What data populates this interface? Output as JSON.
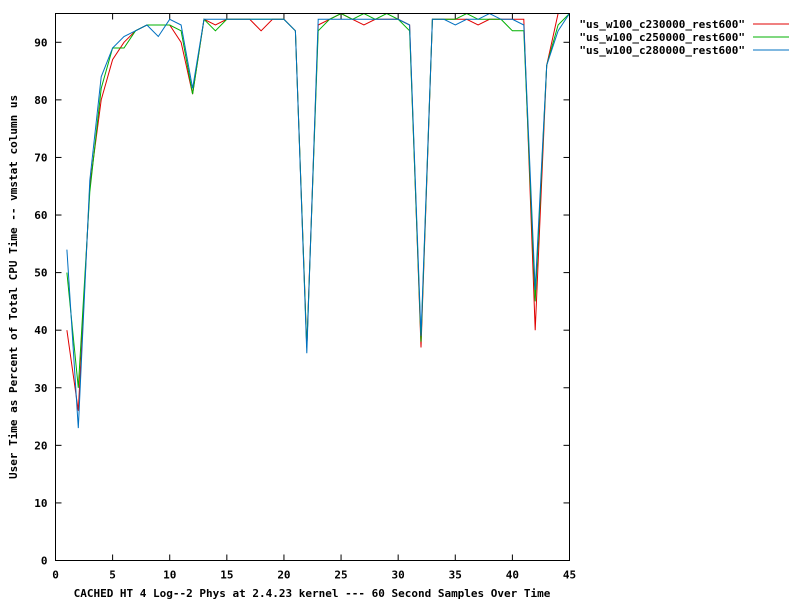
{
  "chart_data": {
    "type": "line",
    "title": "",
    "xlabel": "CACHED HT 4 Log--2 Phys at 2.4.23 kernel --- 60 Second Samples Over Time",
    "ylabel": "User Time as Percent of Total CPU Time -- vmstat column us",
    "xlim": [
      0,
      45
    ],
    "ylim": [
      0,
      95
    ],
    "xticks": [
      0,
      5,
      10,
      15,
      20,
      25,
      30,
      35,
      40,
      45
    ],
    "yticks": [
      0,
      10,
      20,
      30,
      40,
      50,
      60,
      70,
      80,
      90
    ],
    "grid": false,
    "legend_position": "top-right, outside plot",
    "x": [
      1,
      2,
      3,
      4,
      5,
      6,
      7,
      8,
      9,
      10,
      11,
      12,
      13,
      14,
      15,
      16,
      17,
      18,
      19,
      20,
      21,
      22,
      23,
      24,
      25,
      26,
      27,
      28,
      29,
      30,
      31,
      32,
      33,
      34,
      35,
      36,
      37,
      38,
      39,
      40,
      41,
      42,
      43,
      44,
      45
    ],
    "series": [
      {
        "name": "\"us_w100_c230000_rest600\"",
        "color": "#e00000",
        "values": [
          40,
          26,
          65,
          80,
          87,
          90,
          92,
          93,
          93,
          93,
          90,
          81,
          94,
          93,
          94,
          94,
          94,
          92,
          94,
          94,
          92,
          37,
          93,
          94,
          95,
          94,
          93,
          94,
          94,
          94,
          93,
          37,
          94,
          94,
          94,
          94,
          93,
          94,
          94,
          94,
          94,
          40,
          86,
          95,
          95
        ]
      },
      {
        "name": "\"us_w100_c250000_rest600\"",
        "color": "#00b000",
        "values": [
          50,
          30,
          64,
          82,
          89,
          89,
          92,
          93,
          93,
          93,
          92,
          81,
          94,
          92,
          94,
          94,
          94,
          94,
          94,
          94,
          92,
          37,
          92,
          94,
          95,
          94,
          95,
          94,
          95,
          94,
          92,
          38,
          94,
          94,
          94,
          95,
          94,
          94,
          94,
          92,
          92,
          45,
          86,
          93,
          95
        ]
      },
      {
        "name": "\"us_w100_c280000_rest600\"",
        "color": "#0070c0",
        "values": [
          54,
          23,
          66,
          84,
          89,
          91,
          92,
          93,
          91,
          94,
          93,
          82,
          94,
          94,
          94,
          94,
          94,
          94,
          94,
          94,
          92,
          36,
          94,
          94,
          94,
          94,
          94,
          94,
          94,
          94,
          93,
          39,
          94,
          94,
          93,
          94,
          94,
          95,
          94,
          94,
          93,
          47,
          86,
          92,
          95
        ]
      }
    ]
  }
}
